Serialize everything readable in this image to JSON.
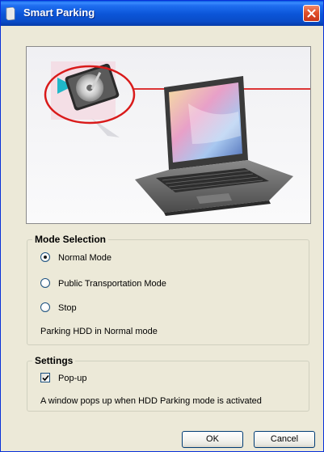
{
  "window": {
    "title": "Smart Parking",
    "close_label": "×"
  },
  "illustration": {
    "description_icon": "laptop-hdd-illustration"
  },
  "mode_selection": {
    "legend": "Mode Selection",
    "options": [
      {
        "label": "Normal Mode",
        "selected": true
      },
      {
        "label": "Public Transportation Mode",
        "selected": false
      },
      {
        "label": "Stop",
        "selected": false
      }
    ],
    "status_text": "Parking HDD in Normal mode"
  },
  "settings": {
    "legend": "Settings",
    "popup_label": "Pop-up",
    "popup_checked": true,
    "description": "A window pops up when HDD Parking mode is activated"
  },
  "buttons": {
    "ok_label": "OK",
    "cancel_label": "Cancel"
  },
  "colors": {
    "titlebar": "#0B55D8",
    "window_bg": "#ECE9D8",
    "close_btn": "#E2512A",
    "highlight_circle": "#D91A1A"
  }
}
